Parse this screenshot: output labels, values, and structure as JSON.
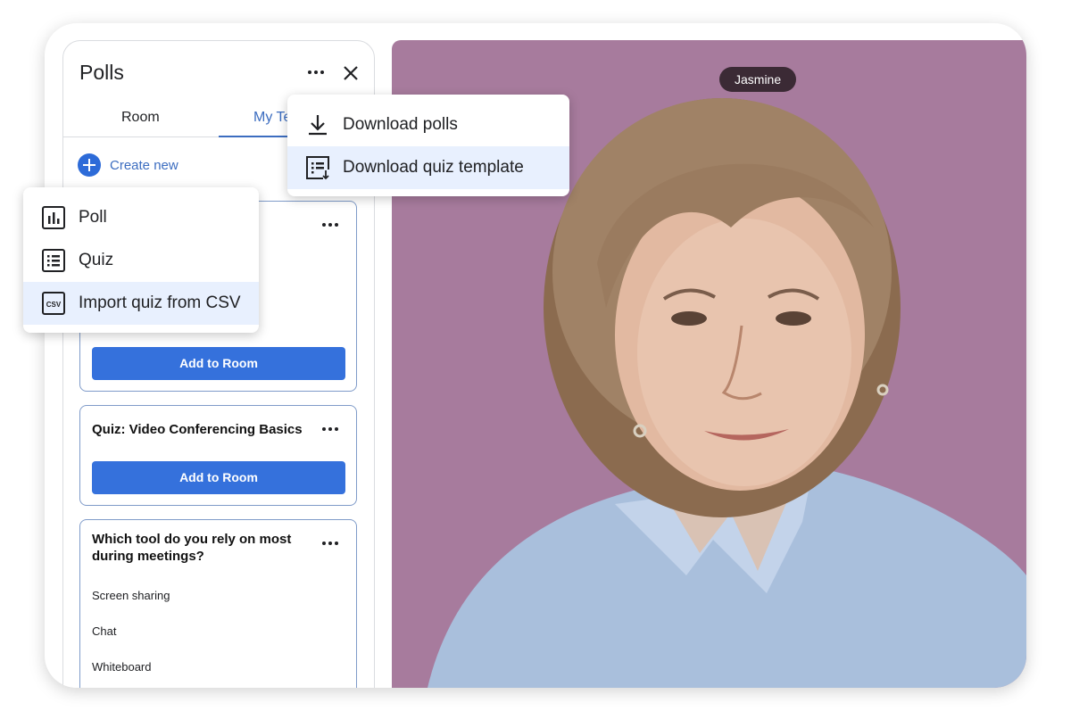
{
  "video": {
    "participant_name": "Jasmine",
    "background_color": "#a77b9d"
  },
  "panel": {
    "title": "Polls",
    "tabs": [
      {
        "label": "Room",
        "active": false
      },
      {
        "label": "My Te",
        "active": true
      }
    ],
    "create_new_label": "Create new",
    "cards": [
      {
        "title": "",
        "button": "Add to Room"
      },
      {
        "title": "Quiz: Video Conferencing Basics",
        "button": "Add to Room"
      },
      {
        "title": "Which tool do you rely on most during meetings?",
        "options": [
          "Screen sharing",
          "Chat",
          "Whiteboard"
        ]
      }
    ]
  },
  "create_menu": {
    "items": [
      {
        "label": "Poll",
        "icon": "bar-chart-icon"
      },
      {
        "label": "Quiz",
        "icon": "list-icon"
      },
      {
        "label": "Import quiz from CSV",
        "icon": "csv-icon",
        "highlighted": true
      }
    ],
    "csv_icon_text": "CSV"
  },
  "more_menu": {
    "items": [
      {
        "label": "Download polls",
        "icon": "download-icon"
      },
      {
        "label": "Download quiz template",
        "icon": "download-template-icon",
        "highlighted": true
      }
    ]
  },
  "colors": {
    "accent": "#3571dc",
    "link": "#3c6dc0",
    "highlight": "#e8f0fe"
  }
}
